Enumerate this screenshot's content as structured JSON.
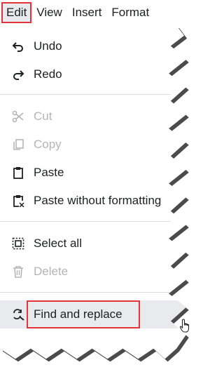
{
  "menubar": {
    "menus": [
      "Edit",
      "View",
      "Insert",
      "Format"
    ]
  },
  "edit_menu": {
    "items": {
      "undo": {
        "label": "Undo",
        "icon": "undo-icon"
      },
      "redo": {
        "label": "Redo",
        "icon": "redo-icon"
      },
      "cut": {
        "label": "Cut",
        "icon": "scissors-icon",
        "enabled": false
      },
      "copy": {
        "label": "Copy",
        "icon": "copy-icon",
        "enabled": false
      },
      "paste": {
        "label": "Paste",
        "icon": "clipboard-icon"
      },
      "paste_plain": {
        "label": "Paste without formatting",
        "icon": "clipboard-clear-format-icon"
      },
      "select_all": {
        "label": "Select all",
        "icon": "select-all-icon"
      },
      "delete": {
        "label": "Delete",
        "icon": "trash-icon",
        "enabled": false
      },
      "find_replace": {
        "label": "Find and replace",
        "icon": "find-replace-icon",
        "highlighted": true
      }
    }
  },
  "colors": {
    "highlight_border": "#e0353b",
    "disabled_text": "#b5b5b5",
    "hover_background": "#e8eaed"
  }
}
